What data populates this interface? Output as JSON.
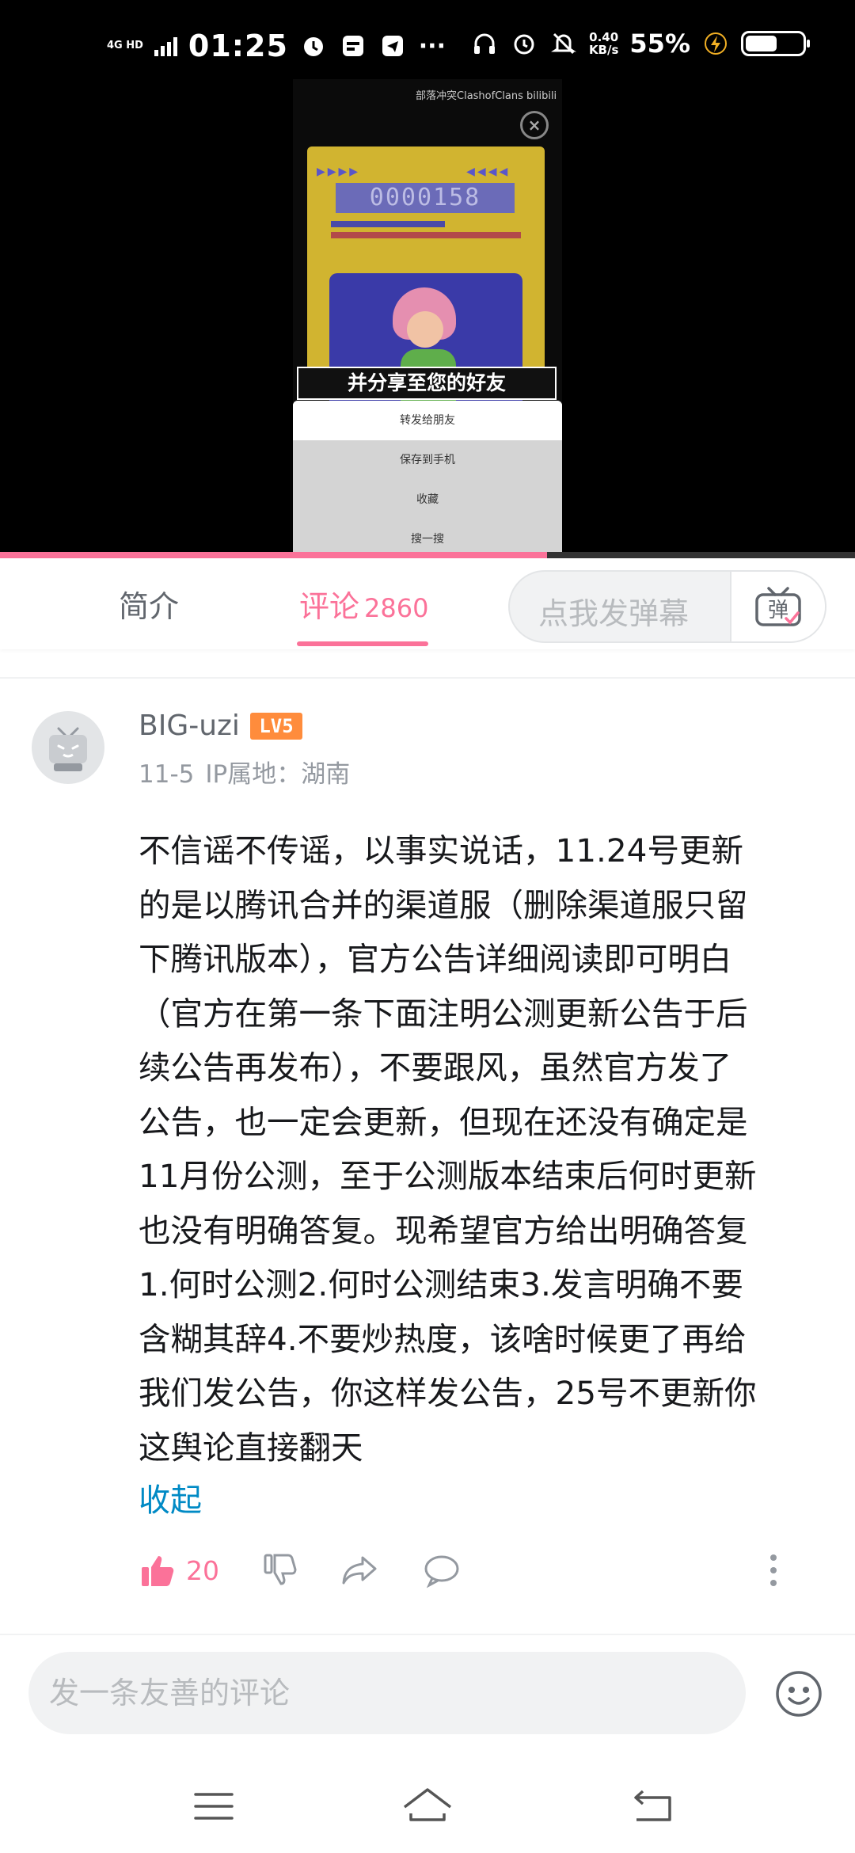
{
  "status_bar": {
    "network": "4G HD",
    "time": "01:25",
    "net_speed_value": "0.40",
    "net_speed_unit": "KB/s",
    "battery_percent": "55%",
    "battery_level": 0.55
  },
  "video": {
    "watermark": "部落冲突ClashofClans bilibili",
    "counter": "0000158",
    "subtitle": "并分享至您的好友",
    "share_menu": [
      "转发给朋友",
      "保存到手机",
      "收藏",
      "搜一搜"
    ],
    "progress": 0.64
  },
  "tabs": {
    "intro": "简介",
    "comments": "评论",
    "comments_count": "2860",
    "danmaku_placeholder": "点我发弹幕",
    "danmaku_button": "弹"
  },
  "comment": {
    "username": "BIG-uzi",
    "level": "LV5",
    "date": "11-5",
    "ip_location": "IP属地：湖南",
    "text_lines": [
      "不信谣不传谣，以事实说话，11.24号更新",
      "的是以腾讯合并的渠道服（删除渠道服只留",
      "下腾讯版本），官方公告详细阅读即可明白",
      "（官方在第一条下面注明公测更新公告于后",
      "续公告再发布），不要跟风，虽然官方发了",
      "公告，也一定会更新，但现在还没有确定是",
      "11月份公测，至于公测版本结束后何时更新",
      "也没有明确答复。现希望官方给出明确答复",
      "1.何时公测2.何时公测结束3.发言明确不要",
      "含糊其辞4.不要炒热度，该啥时候更了再给",
      "我们发公告，你这样发公告，25号不更新你",
      "这舆论直接翻天"
    ],
    "collapse_label": "收起",
    "like_count": "20"
  },
  "input": {
    "placeholder": "发一条友善的评论"
  },
  "colors": {
    "accent": "#fb7299",
    "link": "#008ac5",
    "level_badge": "#ff8c3c"
  },
  "icons": [
    "alarm-icon",
    "sim-icon",
    "telegram-icon",
    "headphones-icon",
    "mute-icon",
    "charging-icon",
    "tv-danmaku-icon",
    "thumb-up-icon",
    "thumb-down-icon",
    "share-icon",
    "reply-icon",
    "more-icon",
    "emoji-icon",
    "menu-icon",
    "home-icon",
    "back-icon"
  ]
}
